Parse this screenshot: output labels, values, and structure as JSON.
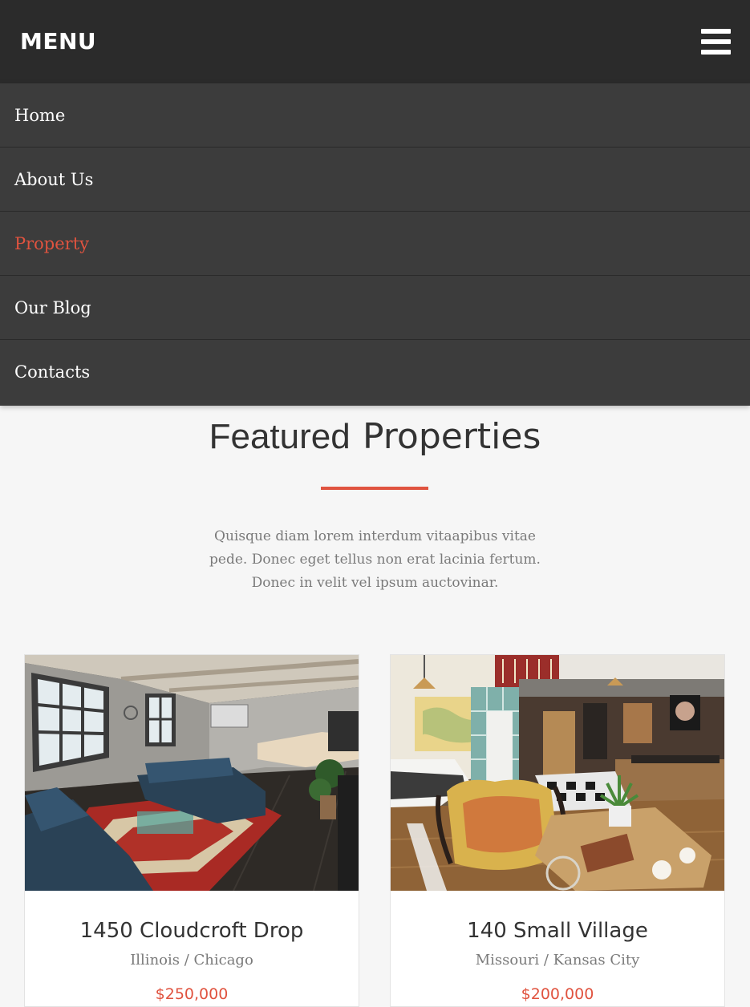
{
  "header": {
    "menu_title": "MENU",
    "menu_icon": "hamburger-icon"
  },
  "nav": {
    "items": [
      {
        "label": "Home",
        "active": false
      },
      {
        "label": "About Us",
        "active": false
      },
      {
        "label": "Property",
        "active": true
      },
      {
        "label": "Our Blog",
        "active": false
      },
      {
        "label": "Contacts",
        "active": false
      }
    ]
  },
  "featured": {
    "title_light": "Featured",
    "title_bold": "Properties",
    "intro": "Quisque diam lorem interdum vitaapibus vitae pede. Donec eget tellus non erat lacinia fertum. Donec in velit vel ipsum auctovinar."
  },
  "properties": [
    {
      "name": "1450 Cloudcroft Drop",
      "location": "Illinois / Chicago",
      "price": "$250,000"
    },
    {
      "name": "140 Small Village",
      "location": "Missouri / Kansas City",
      "price": "$200,000"
    }
  ],
  "colors": {
    "accent": "#e0533f",
    "topbar": "#2b2b2b",
    "nav_bg": "#3c3c3c",
    "page_bg": "#f6f6f6"
  }
}
